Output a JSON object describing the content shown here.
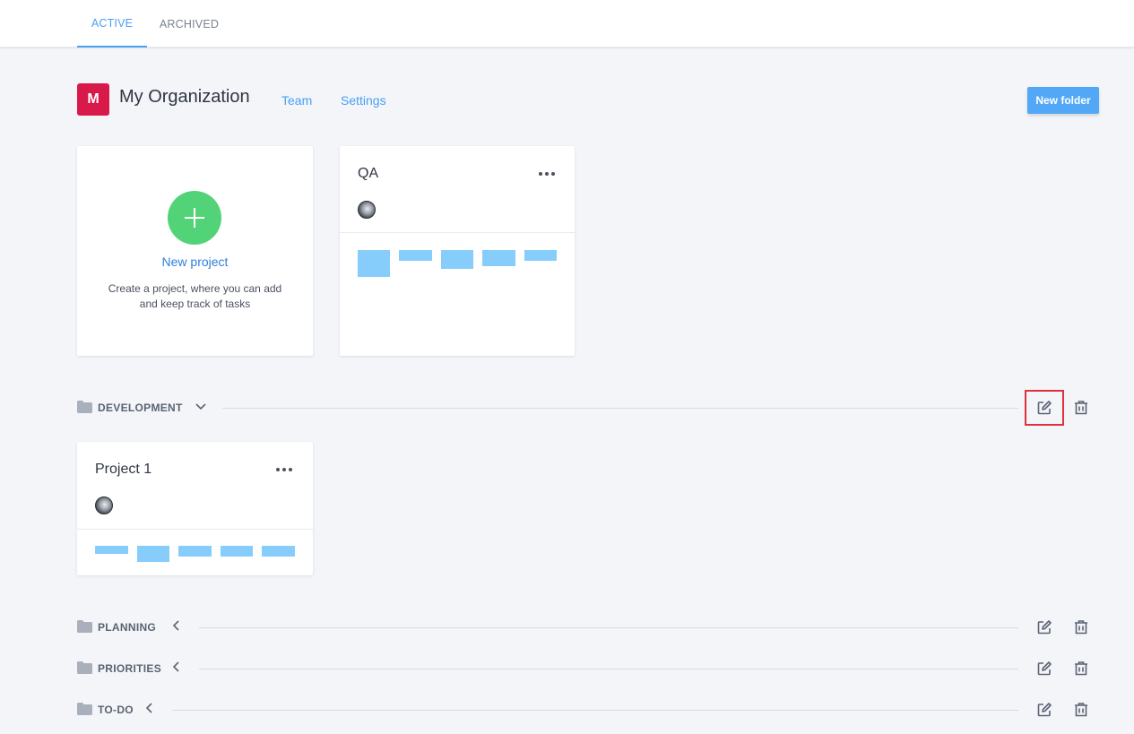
{
  "tabs": [
    {
      "label": "ACTIVE",
      "active": true
    },
    {
      "label": "ARCHIVED",
      "active": false
    }
  ],
  "org": {
    "initial": "M",
    "name": "My Organization",
    "avatar_color": "#d8194a",
    "links": [
      "Team",
      "Settings"
    ]
  },
  "toolbar": {
    "new_folder_label": "New folder"
  },
  "new_project_card": {
    "title": "New project",
    "description": "Create a project, where you can add and keep track of tasks",
    "icon": "plus-icon"
  },
  "projects": [
    {
      "title": "QA",
      "menu_icon": "more-horizontal-icon"
    },
    {
      "title": "Project 1",
      "menu_icon": "more-horizontal-icon"
    }
  ],
  "folders": [
    {
      "label": "DEVELOPMENT",
      "expanded": true,
      "chevron": "chevron-down-icon"
    },
    {
      "label": "PLANNING",
      "expanded": false,
      "chevron": "chevron-left-icon"
    },
    {
      "label": "PRIORITIES",
      "expanded": false,
      "chevron": "chevron-left-icon"
    },
    {
      "label": "TO-DO",
      "expanded": false,
      "chevron": "chevron-left-icon"
    }
  ],
  "colors": {
    "accent": "#4a9ff5",
    "new_project_green": "#52d378",
    "task_bar": "#86cdfc",
    "highlight": "#e0303c"
  }
}
